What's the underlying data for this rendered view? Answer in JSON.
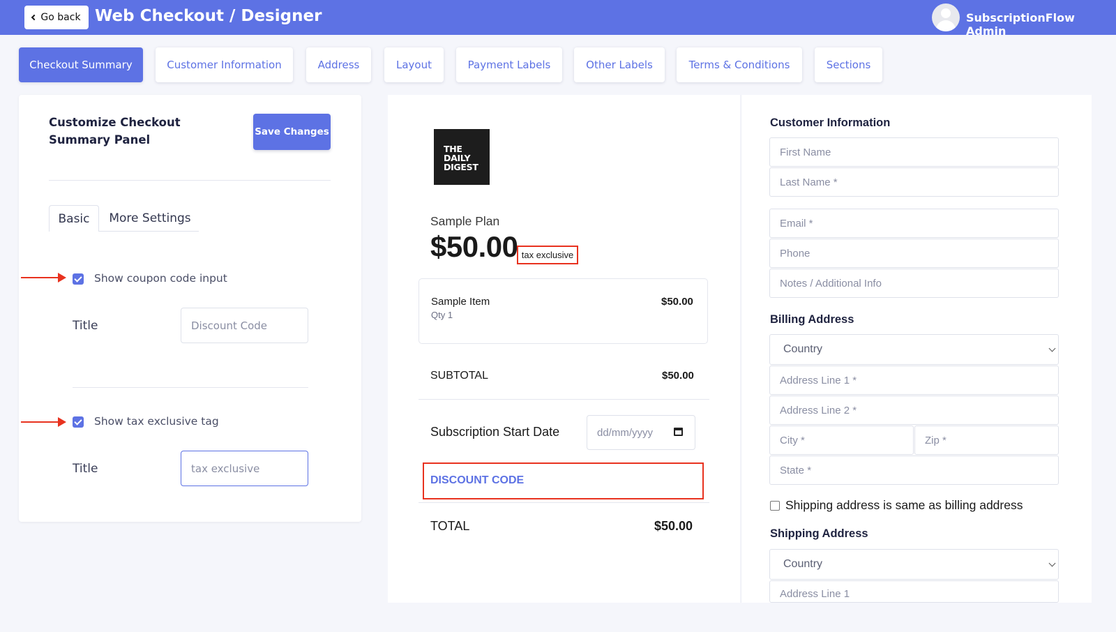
{
  "header": {
    "back_label": "Go back",
    "title": "Web Checkout / Designer",
    "user_name": "SubscriptionFlow Admin",
    "accent_color": "#5d72e4"
  },
  "tabs": [
    {
      "label": "Checkout Summary",
      "active": true
    },
    {
      "label": "Customer Information",
      "active": false
    },
    {
      "label": "Address",
      "active": false
    },
    {
      "label": "Layout",
      "active": false
    },
    {
      "label": "Payment Labels",
      "active": false
    },
    {
      "label": "Other Labels",
      "active": false
    },
    {
      "label": "Terms & Conditions",
      "active": false
    },
    {
      "label": "Sections",
      "active": false
    }
  ],
  "settings": {
    "panel_title": "Customize Checkout Summary Panel",
    "save_label": "Save Changes",
    "subtabs": [
      "Basic",
      "More Settings"
    ],
    "coupon": {
      "checked": true,
      "label": "Show coupon code input",
      "title_label": "Title",
      "title_value": "Discount Code"
    },
    "tax": {
      "checked": true,
      "label": "Show tax exclusive tag",
      "title_label": "Title",
      "title_value": "tax exclusive"
    },
    "annotation_color": "#e8321f"
  },
  "preview": {
    "logo_text": "THE DAILY DIGEST",
    "plan_name": "Sample Plan",
    "price": "$50.00",
    "tax_tag": "tax exclusive",
    "item": {
      "name": "Sample Item",
      "qty": "Qty   1",
      "price": "$50.00"
    },
    "subtotal_label": "SUBTOTAL",
    "subtotal_value": "$50.00",
    "start_date_label": "Subscription Start Date",
    "date_placeholder": "dd/mm/yyyy",
    "discount_label": "DISCOUNT CODE",
    "total_label": "TOTAL",
    "total_value": "$50.00"
  },
  "form": {
    "customer_title": "Customer Information",
    "first_name": "First Name",
    "last_name": "Last Name *",
    "email": "Email *",
    "phone": "Phone",
    "notes": "Notes / Additional Info",
    "billing_title": "Billing Address",
    "billing_country": "Country",
    "address1": "Address Line 1 *",
    "address2": "Address Line 2 *",
    "city": "City *",
    "zip": "Zip *",
    "state": "State *",
    "same_address_label": "Shipping address is same as billing address",
    "shipping_title": "Shipping Address",
    "shipping_country": "Country",
    "shipping_address1": "Address Line 1"
  }
}
